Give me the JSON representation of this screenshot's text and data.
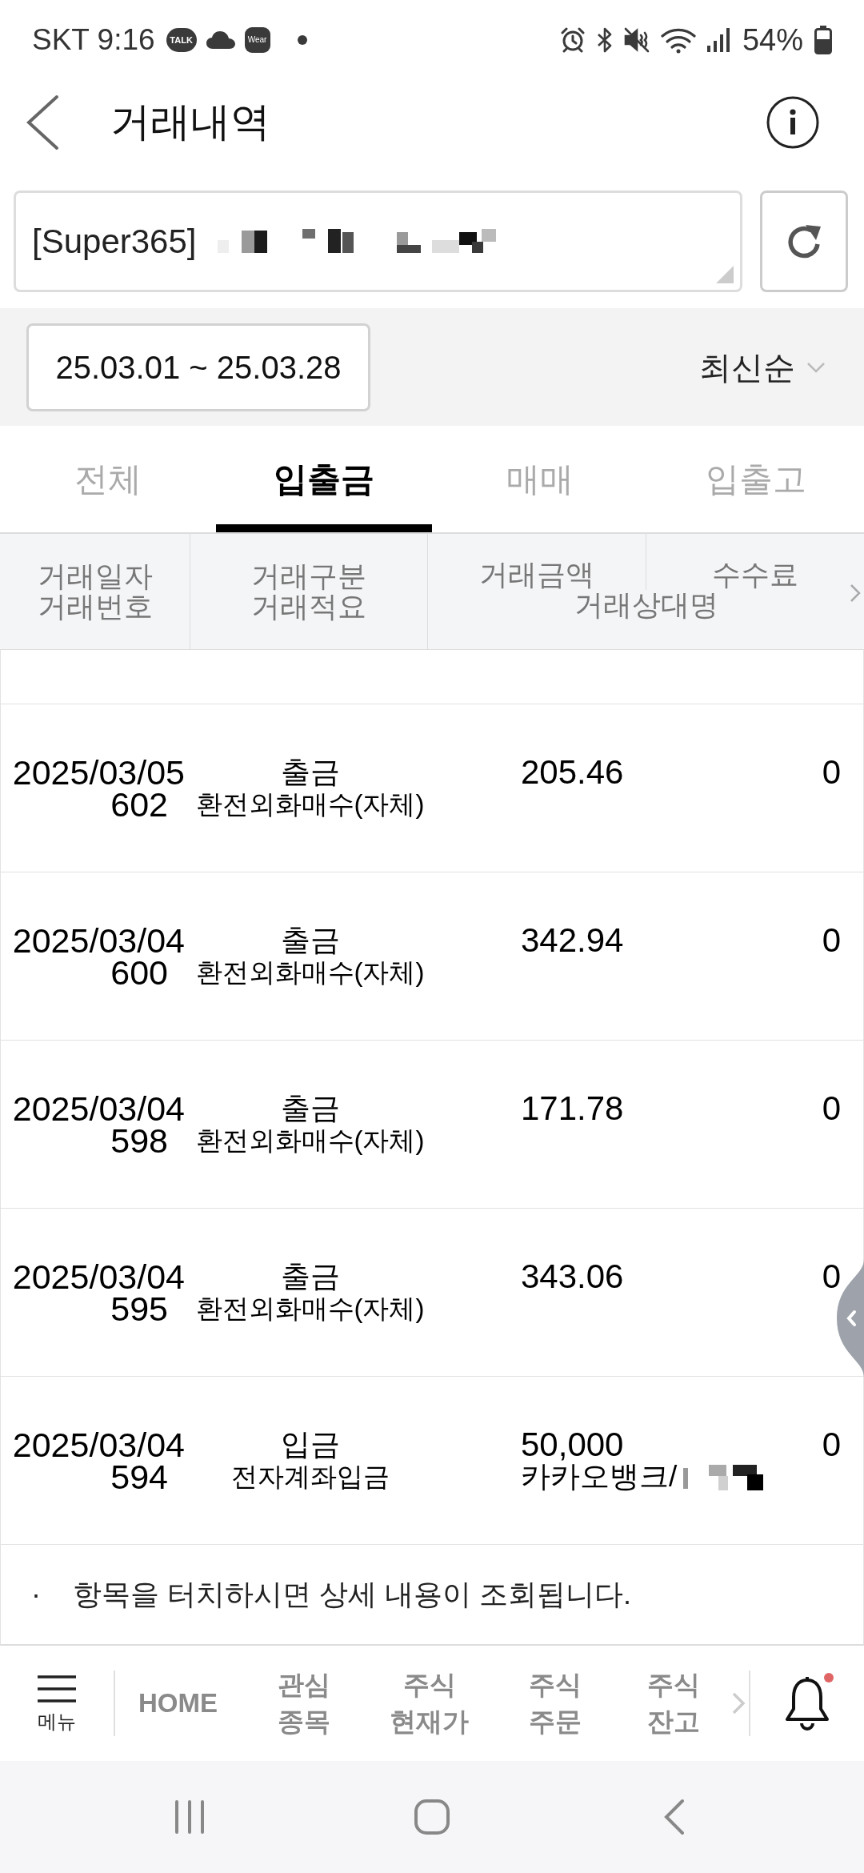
{
  "status_bar": {
    "carrier_time": "SKT 9:16",
    "notification_icons": [
      {
        "kind": "talk",
        "label": "TALK"
      },
      {
        "kind": "cloud"
      },
      {
        "kind": "wear",
        "label": "Wear"
      },
      {
        "kind": "dot"
      }
    ],
    "system_icons": [
      {
        "kind": "alarm"
      },
      {
        "kind": "bluetooth"
      },
      {
        "kind": "mute"
      },
      {
        "kind": "wifi"
      },
      {
        "kind": "signal"
      }
    ],
    "battery": "54%"
  },
  "header": {
    "title": "거래내역"
  },
  "account": {
    "value": "[Super365]",
    "redacted": true
  },
  "filter": {
    "date_range": "25.03.01 ~ 25.03.28",
    "sort": "최신순"
  },
  "tabs": [
    {
      "label": "전체",
      "selected": false
    },
    {
      "label": "입출금",
      "selected": true
    },
    {
      "label": "매매",
      "selected": false
    },
    {
      "label": "입출고",
      "selected": false
    }
  ],
  "table": {
    "columns": [
      {
        "lines": [
          "거래일자",
          "거래번호"
        ]
      },
      {
        "lines": [
          "거래구분",
          "거래적요"
        ]
      }
    ],
    "amount_column": "거래금액",
    "fee_column": "수수료",
    "counterparty_column": "거래상대명",
    "rows": [
      {
        "date": "2025/03/05",
        "number": "602",
        "type": "출금",
        "summary": "환전외화매수(자체)",
        "amount": "205.46",
        "fee": "0"
      },
      {
        "date": "2025/03/04",
        "number": "600",
        "type": "출금",
        "summary": "환전외화매수(자체)",
        "amount": "342.94",
        "fee": "0"
      },
      {
        "date": "2025/03/04",
        "number": "598",
        "type": "출금",
        "summary": "환전외화매수(자체)",
        "amount": "171.78",
        "fee": "0"
      },
      {
        "date": "2025/03/04",
        "number": "595",
        "type": "출금",
        "summary": "환전외화매수(자체)",
        "amount": "343.06",
        "fee": "0"
      },
      {
        "date": "2025/03/04",
        "number": "594",
        "type": "입금",
        "summary": "전자계좌입금",
        "amount": "50,000",
        "fee": "0",
        "counterparty": "카카오뱅크/",
        "counterparty_redacted": true
      }
    ]
  },
  "footnote": {
    "bullet": "·",
    "text": "항목을 터치하시면 상세 내용이 조회됩니다."
  },
  "bottom_nav": {
    "menu_label": "메뉴",
    "items": [
      {
        "lines": [
          "HOME"
        ]
      },
      {
        "lines": [
          "관심",
          "종목"
        ]
      },
      {
        "lines": [
          "주식",
          "현재가"
        ]
      },
      {
        "lines": [
          "주식",
          "주문"
        ]
      },
      {
        "lines": [
          "주식",
          "잔고"
        ]
      }
    ],
    "has_alert": true
  }
}
